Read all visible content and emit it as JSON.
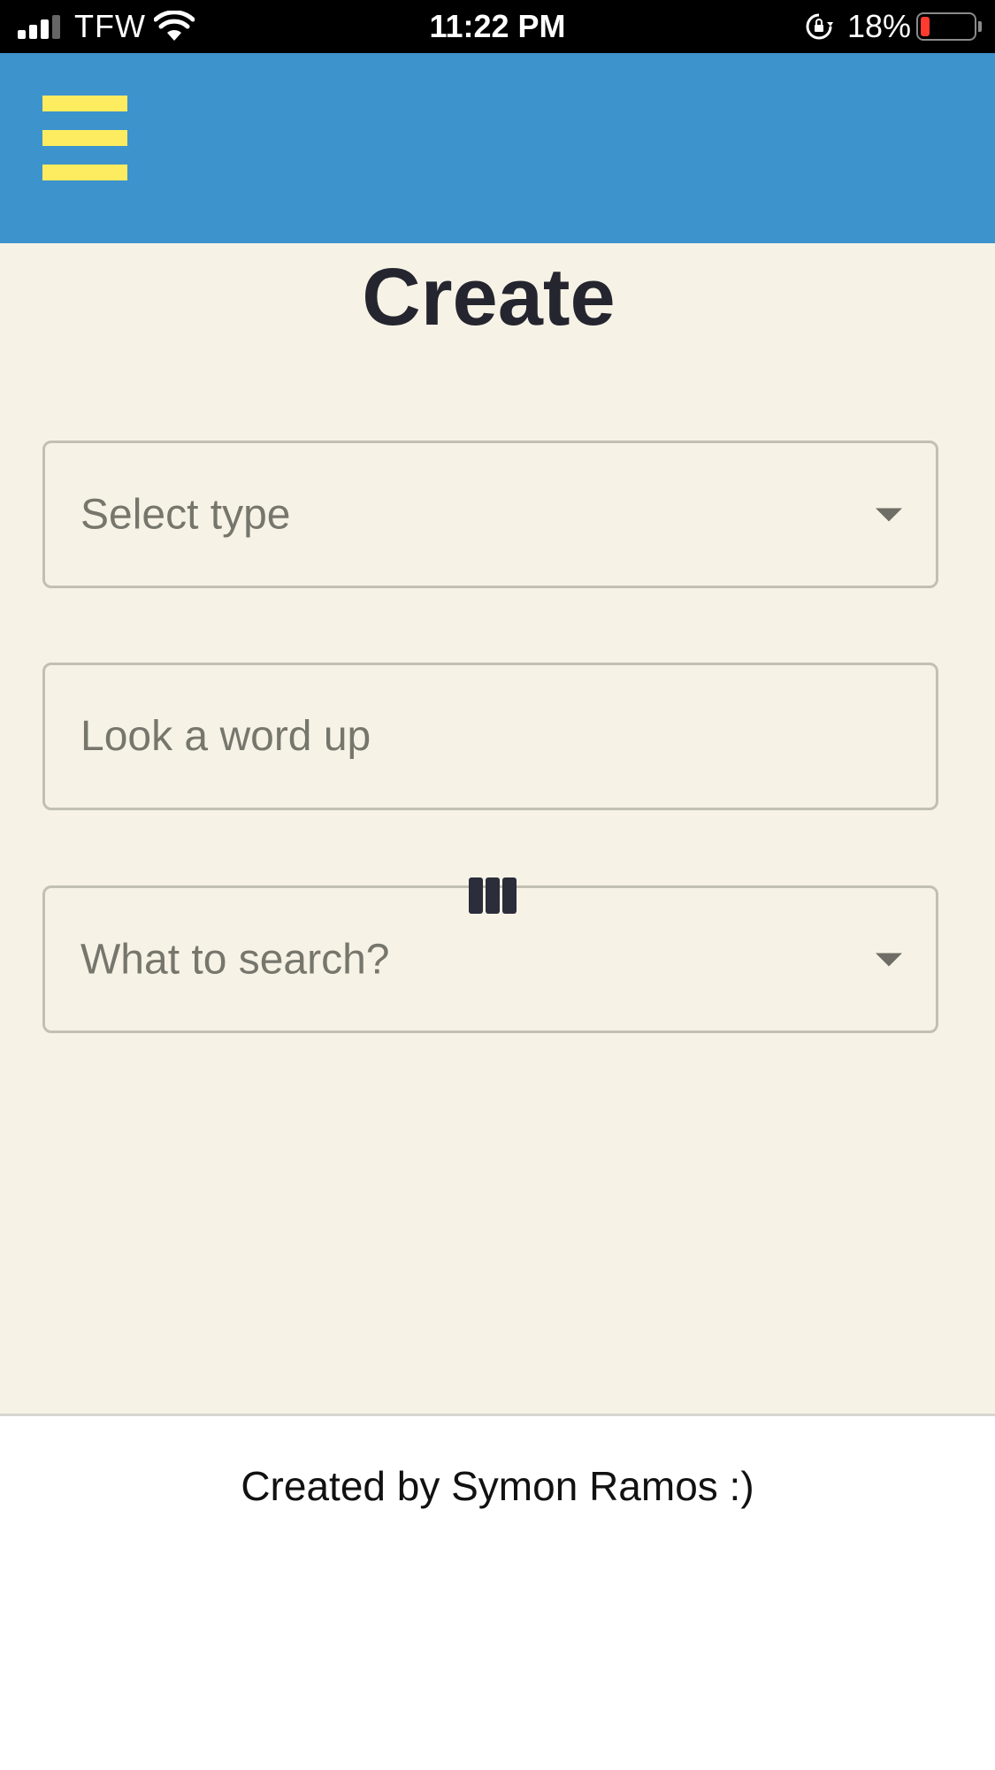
{
  "status_bar": {
    "carrier": "TFW",
    "time": "11:22 PM",
    "battery_percent": "18%",
    "battery_level": 0.18,
    "signal_bars": 3
  },
  "header": {
    "menu_icon": "hamburger-menu-icon",
    "background_color": "#3d93cb",
    "menu_color": "#fdec60"
  },
  "main": {
    "title": "Create",
    "type_select": {
      "placeholder": "Select type"
    },
    "word_input": {
      "placeholder": "Look a word up"
    },
    "search_select": {
      "placeholder": "What to search?"
    },
    "loader_icon": "loading-bars-icon"
  },
  "footer": {
    "credit": "Created by Symon Ramos :)"
  }
}
